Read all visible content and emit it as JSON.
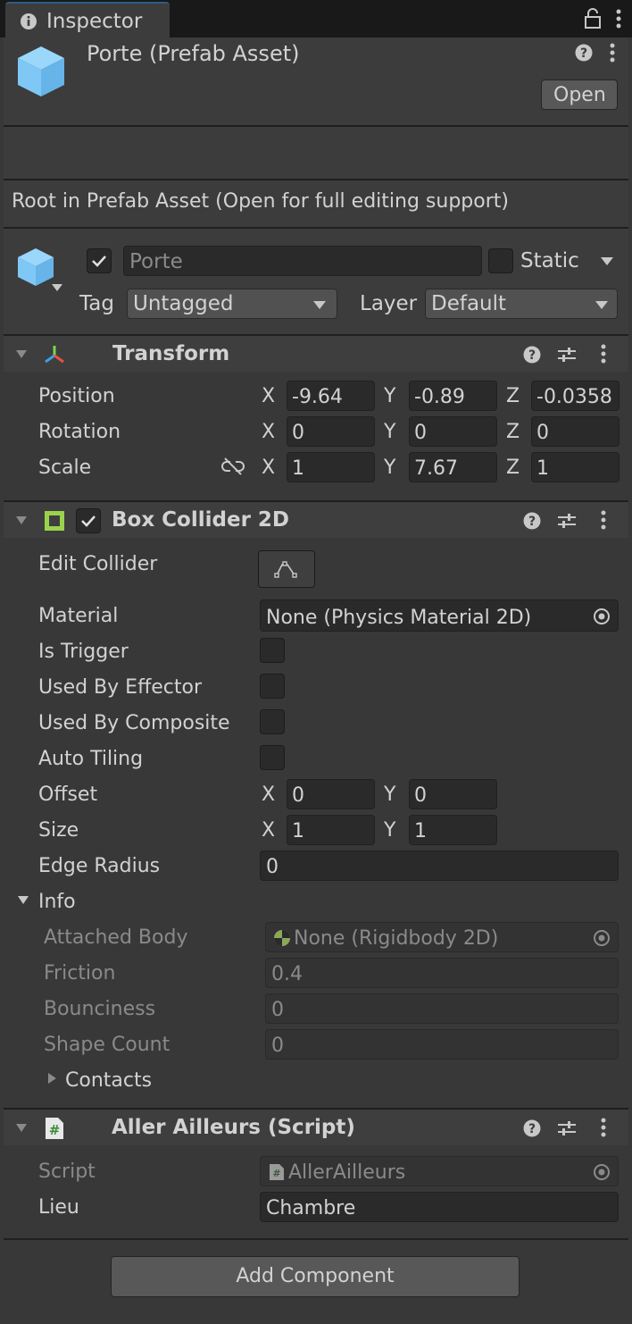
{
  "window": {
    "tab_title": "Inspector"
  },
  "prefab": {
    "title": "Porte (Prefab Asset)",
    "open_label": "Open",
    "info_text": "Root in Prefab Asset (Open for full editing support)"
  },
  "gameobject": {
    "name_placeholder": "Porte",
    "static_label": "Static",
    "tag_label": "Tag",
    "tag_value": "Untagged",
    "layer_label": "Layer",
    "layer_value": "Default"
  },
  "transform": {
    "title": "Transform",
    "rows": [
      {
        "label": "Position",
        "x": "-9.64",
        "y": "-0.89",
        "z": "-0.0358"
      },
      {
        "label": "Rotation",
        "x": "0",
        "y": "0",
        "z": "0"
      },
      {
        "label": "Scale",
        "x": "1",
        "y": "7.67",
        "z": "1"
      }
    ],
    "axis": {
      "x": "X",
      "y": "Y",
      "z": "Z"
    }
  },
  "box_collider": {
    "title": "Box Collider 2D",
    "edit_collider_label": "Edit Collider",
    "material_label": "Material",
    "material_value": "None (Physics Material 2D)",
    "is_trigger_label": "Is Trigger",
    "used_by_effector_label": "Used By Effector",
    "used_by_composite_label": "Used By Composite",
    "auto_tiling_label": "Auto Tiling",
    "offset_label": "Offset",
    "offset_x": "0",
    "offset_y": "0",
    "size_label": "Size",
    "size_x": "1",
    "size_y": "1",
    "edge_radius_label": "Edge Radius",
    "edge_radius_value": "0",
    "info_label": "Info",
    "attached_body_label": "Attached Body",
    "attached_body_value": "None (Rigidbody 2D)",
    "friction_label": "Friction",
    "friction_value": "0.4",
    "bounciness_label": "Bounciness",
    "bounciness_value": "0",
    "shape_count_label": "Shape Count",
    "shape_count_value": "0",
    "contacts_label": "Contacts"
  },
  "script": {
    "title": "Aller Ailleurs (Script)",
    "script_label": "Script",
    "script_value": "AllerAilleurs",
    "lieu_label": "Lieu",
    "lieu_value": "Chambre"
  },
  "add_component_label": "Add Component",
  "icons": [
    "info-icon",
    "lock-icon",
    "kebab-menu-icon",
    "prefab-cube-icon",
    "help-icon",
    "preset-sliders-icon",
    "transform-axes-icon",
    "box-collider-icon",
    "script-hash-icon",
    "object-picker-icon",
    "constrain-proportions-icon",
    "rigidbody-icon",
    "foldout-arrow-icon",
    "dropdown-arrow-icon",
    "edit-collider-icon"
  ],
  "colors": {
    "accent_tab": "#2c5d87",
    "cube_icon": "#7fc8f5",
    "collider_icon": "#9bd24d",
    "panel": "#383838"
  }
}
